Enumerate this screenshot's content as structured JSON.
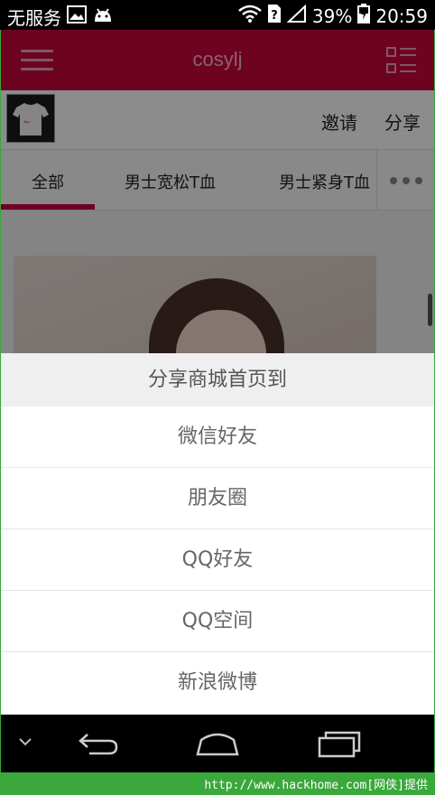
{
  "status_bar": {
    "carrier": "无服务",
    "signal_icon": "wifi-icon",
    "battery_percent": "39%",
    "time": "20:59"
  },
  "app_bar": {
    "title": "cosylj",
    "menu_icon": "hamburger-icon",
    "grid_icon": "list-grid-icon"
  },
  "shop_bar": {
    "invite_label": "邀请",
    "share_label": "分享"
  },
  "tabs": [
    {
      "label": "全部",
      "active": true
    },
    {
      "label": "男士宽松T血",
      "active": false
    },
    {
      "label": "男士紧身T血",
      "active": false
    }
  ],
  "share_sheet": {
    "title": "分享商城首页到",
    "options": [
      "微信好友",
      "朋友圈",
      "QQ好友",
      "QQ空间",
      "新浪微博"
    ]
  },
  "watermark": "http://www.hackhome.com[网侠]提供",
  "colors": {
    "brand": "#c8073d",
    "footer_green": "#3aa83a"
  }
}
